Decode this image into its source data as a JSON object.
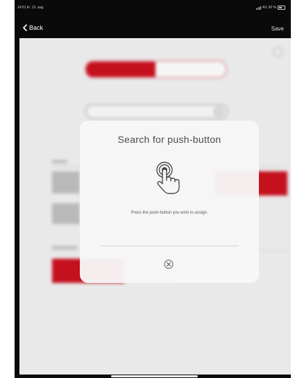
{
  "status_bar": {
    "time_date": "14:51  tir. 13. aug.",
    "network": "4G",
    "battery": "50 %"
  },
  "nav": {
    "back_label": "Back",
    "save_label": "Save"
  },
  "modal": {
    "title": "Search for push-button",
    "message": "Press the push-button you wish to assign."
  },
  "icons": [
    "chevron-left-icon",
    "signal-icon",
    "battery-icon",
    "touch-finger-icon",
    "close-circle-icon"
  ],
  "colors": {
    "brand_red": "#c5101e",
    "device_black": "#0a0a0a",
    "content_background": "#e9e9e9",
    "modal_background": "#f7f7f7"
  }
}
